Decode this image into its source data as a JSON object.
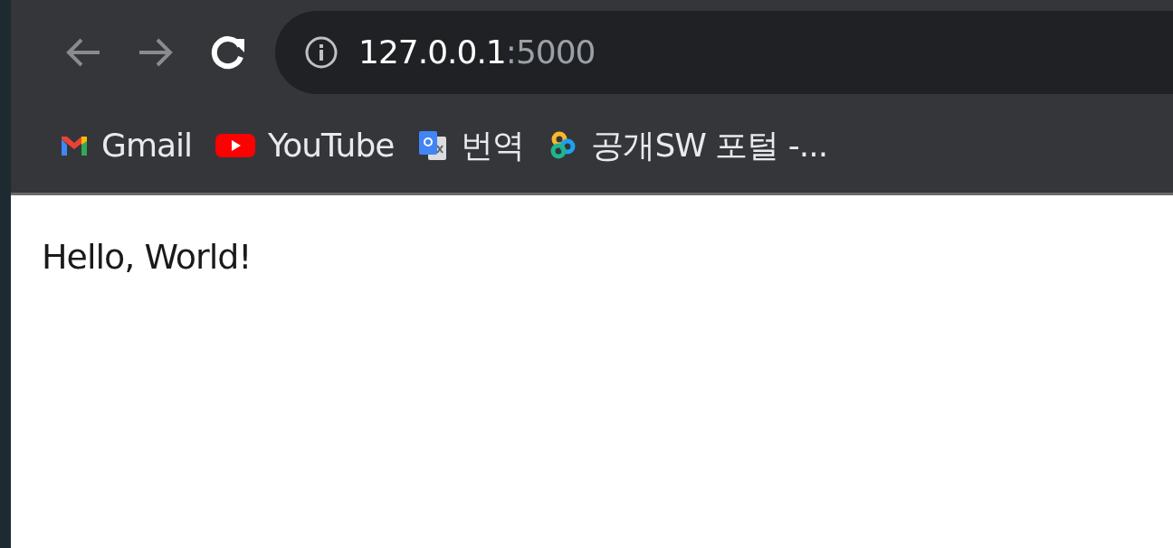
{
  "toolbar": {
    "back": {
      "disabled": true
    },
    "forward": {
      "disabled": true
    },
    "address": {
      "host": "127.0.0.1",
      "port": ":5000"
    }
  },
  "bookmarks": [
    {
      "kind": "mail",
      "label": "Gmail"
    },
    {
      "kind": "video",
      "label": "YouTube"
    },
    {
      "kind": "translate",
      "label": "번역"
    },
    {
      "kind": "rings",
      "label": "공개SW 포털 -..."
    }
  ],
  "page": {
    "text": "Hello, World!"
  }
}
